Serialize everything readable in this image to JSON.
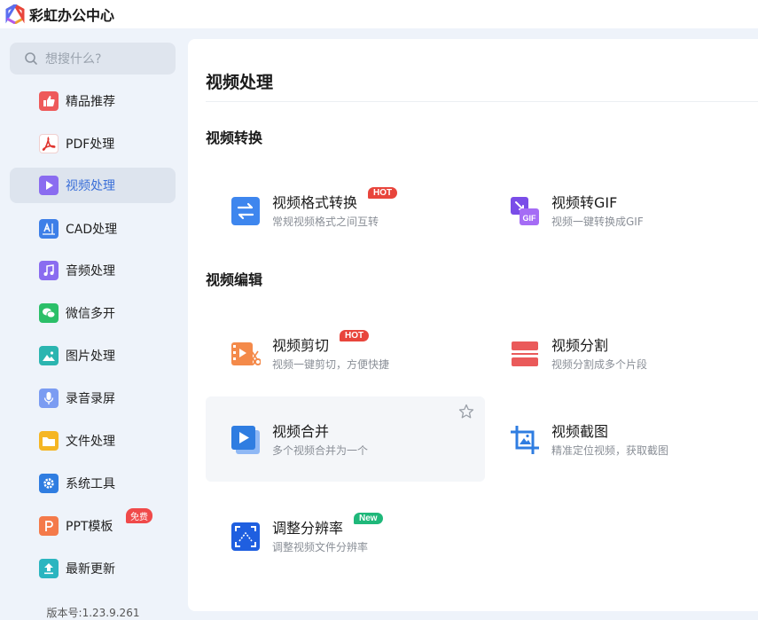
{
  "app": {
    "title": "彩虹办公中心"
  },
  "search": {
    "placeholder": "想搜什么?"
  },
  "sidebar": {
    "items": [
      {
        "label": "精品推荐",
        "icon": "thumbs-up-icon",
        "color": "#ee5a5a"
      },
      {
        "label": "PDF处理",
        "icon": "pdf-icon",
        "color": "#ffffff"
      },
      {
        "label": "视频处理",
        "icon": "play-icon",
        "color": "#8a6cf0",
        "active": true
      },
      {
        "label": "CAD处理",
        "icon": "cad-icon",
        "color": "#3d7fe8"
      },
      {
        "label": "音频处理",
        "icon": "music-icon",
        "color": "#8a6cf0"
      },
      {
        "label": "微信多开",
        "icon": "wechat-icon",
        "color": "#2bbf68"
      },
      {
        "label": "图片处理",
        "icon": "image-icon",
        "color": "#2bb5b0"
      },
      {
        "label": "录音录屏",
        "icon": "microphone-icon",
        "color": "#7b9cf2"
      },
      {
        "label": "文件处理",
        "icon": "folder-icon",
        "color": "#f5b623"
      },
      {
        "label": "系统工具",
        "icon": "gear-icon",
        "color": "#2f7de1"
      },
      {
        "label": "PPT模板",
        "icon": "ppt-icon",
        "color": "#f47a4a",
        "badge": "免费"
      },
      {
        "label": "最新更新",
        "icon": "upload-icon",
        "color": "#2bb5c0"
      }
    ]
  },
  "version": "版本号:1.23.9.261",
  "main": {
    "title": "视频处理",
    "sections": [
      {
        "title": "视频转换",
        "cards": [
          {
            "title": "视频格式转换",
            "desc": "常规视频格式之间互转",
            "tag": "HOT",
            "icon": "convert-arrows-icon"
          },
          {
            "title": "视频转GIF",
            "desc": "视频一键转换成GIF",
            "icon": "gif-icon"
          }
        ]
      },
      {
        "title": "视频编辑",
        "cards": [
          {
            "title": "视频剪切",
            "desc": "视频一键剪切，方便快捷",
            "tag": "HOT",
            "icon": "video-cut-icon"
          },
          {
            "title": "视频分割",
            "desc": "视频分割成多个片段",
            "icon": "split-icon"
          },
          {
            "title": "视频合并",
            "desc": "多个视频合并为一个",
            "icon": "merge-icon"
          },
          {
            "title": "视频截图",
            "desc": "精准定位视频，获取截图",
            "icon": "crop-icon"
          },
          {
            "title": "调整分辨率",
            "desc": "调整视频文件分辨率",
            "tag": "New",
            "icon": "resolution-icon"
          }
        ]
      }
    ]
  },
  "colors": {
    "accent": "#3a6fd8",
    "hot": "#e8453c",
    "new": "#1fb87a"
  }
}
